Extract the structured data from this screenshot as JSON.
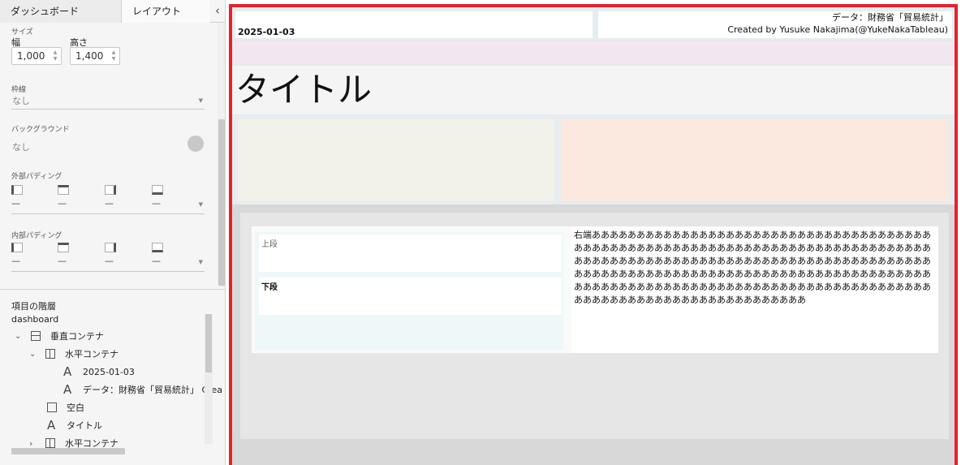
{
  "tabs": {
    "dashboard": "ダッシュボード",
    "layout": "レイアウト"
  },
  "size": {
    "label": "サイズ",
    "width_label": "幅",
    "height_label": "高さ",
    "width_value": "1,000",
    "height_value": "1,400"
  },
  "border": {
    "label": "枠線",
    "value": "なし"
  },
  "background": {
    "label": "バックグラウンド",
    "value": "なし",
    "swatch_color": "#c8c8c8"
  },
  "outer_padding": {
    "label": "外部パディング",
    "values": [
      "—",
      "—",
      "—",
      "—"
    ]
  },
  "inner_padding": {
    "label": "内部パディング",
    "values": [
      "—",
      "—",
      "—",
      "—"
    ]
  },
  "hierarchy": {
    "title": "項目の階層",
    "root": "dashboard",
    "items": [
      {
        "label": "垂直コンテナ",
        "icon": "vertical-container-icon",
        "toggle": "⌄"
      },
      {
        "label": "水平コンテナ",
        "icon": "horizontal-container-icon",
        "toggle": "⌄"
      },
      {
        "label": "2025-01-03",
        "icon": "text-icon",
        "toggle": ""
      },
      {
        "label": "データ：財務省「貿易統計」 Crea",
        "icon": "text-icon",
        "toggle": ""
      },
      {
        "label": "空白",
        "icon": "blank-icon",
        "toggle": ""
      },
      {
        "label": "タイトル",
        "icon": "text-icon",
        "toggle": ""
      },
      {
        "label": "水平コンテナ",
        "icon": "horizontal-container-icon",
        "toggle": "›"
      }
    ]
  },
  "canvas": {
    "date": "2025-01-03",
    "source_line1": "データ：財務省「貿易統計」",
    "source_line2": "Created by Yusuke Nakajima(@YukeNakaTableau)",
    "title": "タイトル",
    "upper_label": "上段",
    "lower_label": "下段",
    "right_text": "右端ああああああああああああああああああああああああああああああああああああああああああああああああああああああああああああああああああああああああああああああああああああああああああああああああああああああああああああああああああああああああああああああああああああああああああああああああああああああああああああああああああああああああああああああああああああああああああああああああああああああああああああああああああああああああああああああああ"
  },
  "colors": {
    "accent_border": "#e8202c",
    "header_bg": "#e3efee",
    "pink_band": "#f2e6f1",
    "kpi_left": "#f2f1ea",
    "kpi_right": "#fbe9e0"
  }
}
